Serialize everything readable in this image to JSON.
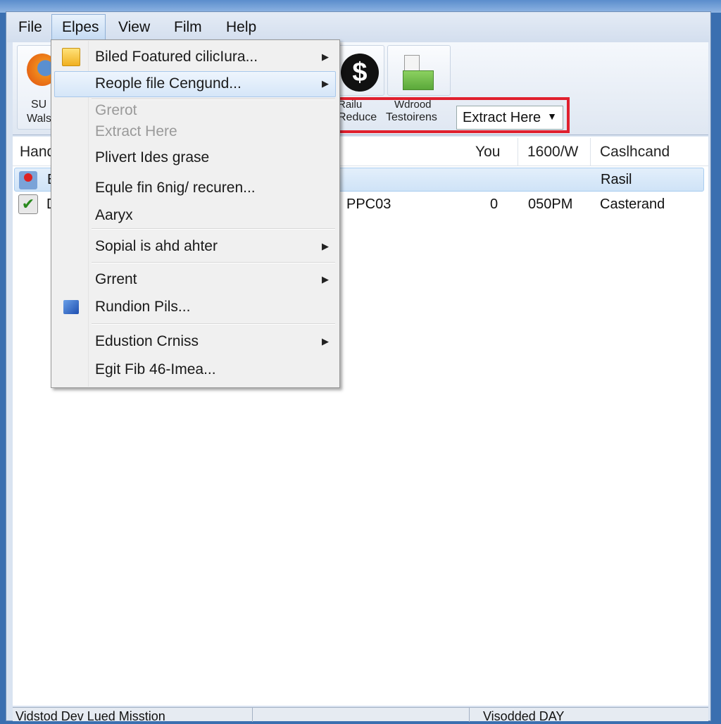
{
  "menubar": {
    "items": [
      "File",
      "Elpes",
      "View",
      "Film",
      "Help"
    ],
    "active": "Elpes"
  },
  "toolbar": {
    "buttons": [
      {
        "label1": "SU",
        "label2": "Wals",
        "icon": "browser-globe-icon"
      },
      {
        "label1": "Railu",
        "label2": "Reduce",
        "icon": "dollar-circle-icon"
      },
      {
        "label1": "Wdrood",
        "label2": "Testoirens",
        "icon": "green-archive-icon"
      }
    ],
    "combo_value": "Extract Here",
    "highlight_color": "#e0202e"
  },
  "dropdown": {
    "items": [
      {
        "label": "Biled Foatured cilicIura...",
        "submenu": true,
        "icon": "folder-star-icon"
      },
      {
        "label": "Reople file Cengund...",
        "submenu": true,
        "highlighted": true
      },
      {
        "label": "Grerot",
        "disabled": true
      },
      {
        "label": "Extract Here",
        "disabled": true
      },
      {
        "label": "Plivert Ides grase"
      },
      {
        "label": "Equle fin 6nig/ recuren..."
      },
      {
        "label": "Aaryx"
      },
      {
        "label": "Sopial is ahd ahter",
        "submenu": true
      },
      {
        "label": "Grrent",
        "submenu": true
      },
      {
        "label": "Rundion Pils...",
        "icon": "blue-window-icon"
      },
      {
        "label": "Edustion Crniss",
        "submenu": true
      },
      {
        "label": "Egit Fib 46-Imea..."
      }
    ]
  },
  "list": {
    "columns": [
      "Hand",
      "You",
      "1600/W",
      "Caslhcand"
    ],
    "rows": [
      {
        "name": "E",
        "col2": "",
        "col3": "",
        "col4": "",
        "col5": "Rasil",
        "selected": true
      },
      {
        "name": "D",
        "col2": "PPC03",
        "col3": "0",
        "col4": "050PM",
        "col5": "Casterand"
      }
    ]
  },
  "statusbar": {
    "left": "Vidstod Dev Lued Misstion",
    "right": "Visodded DAY"
  }
}
